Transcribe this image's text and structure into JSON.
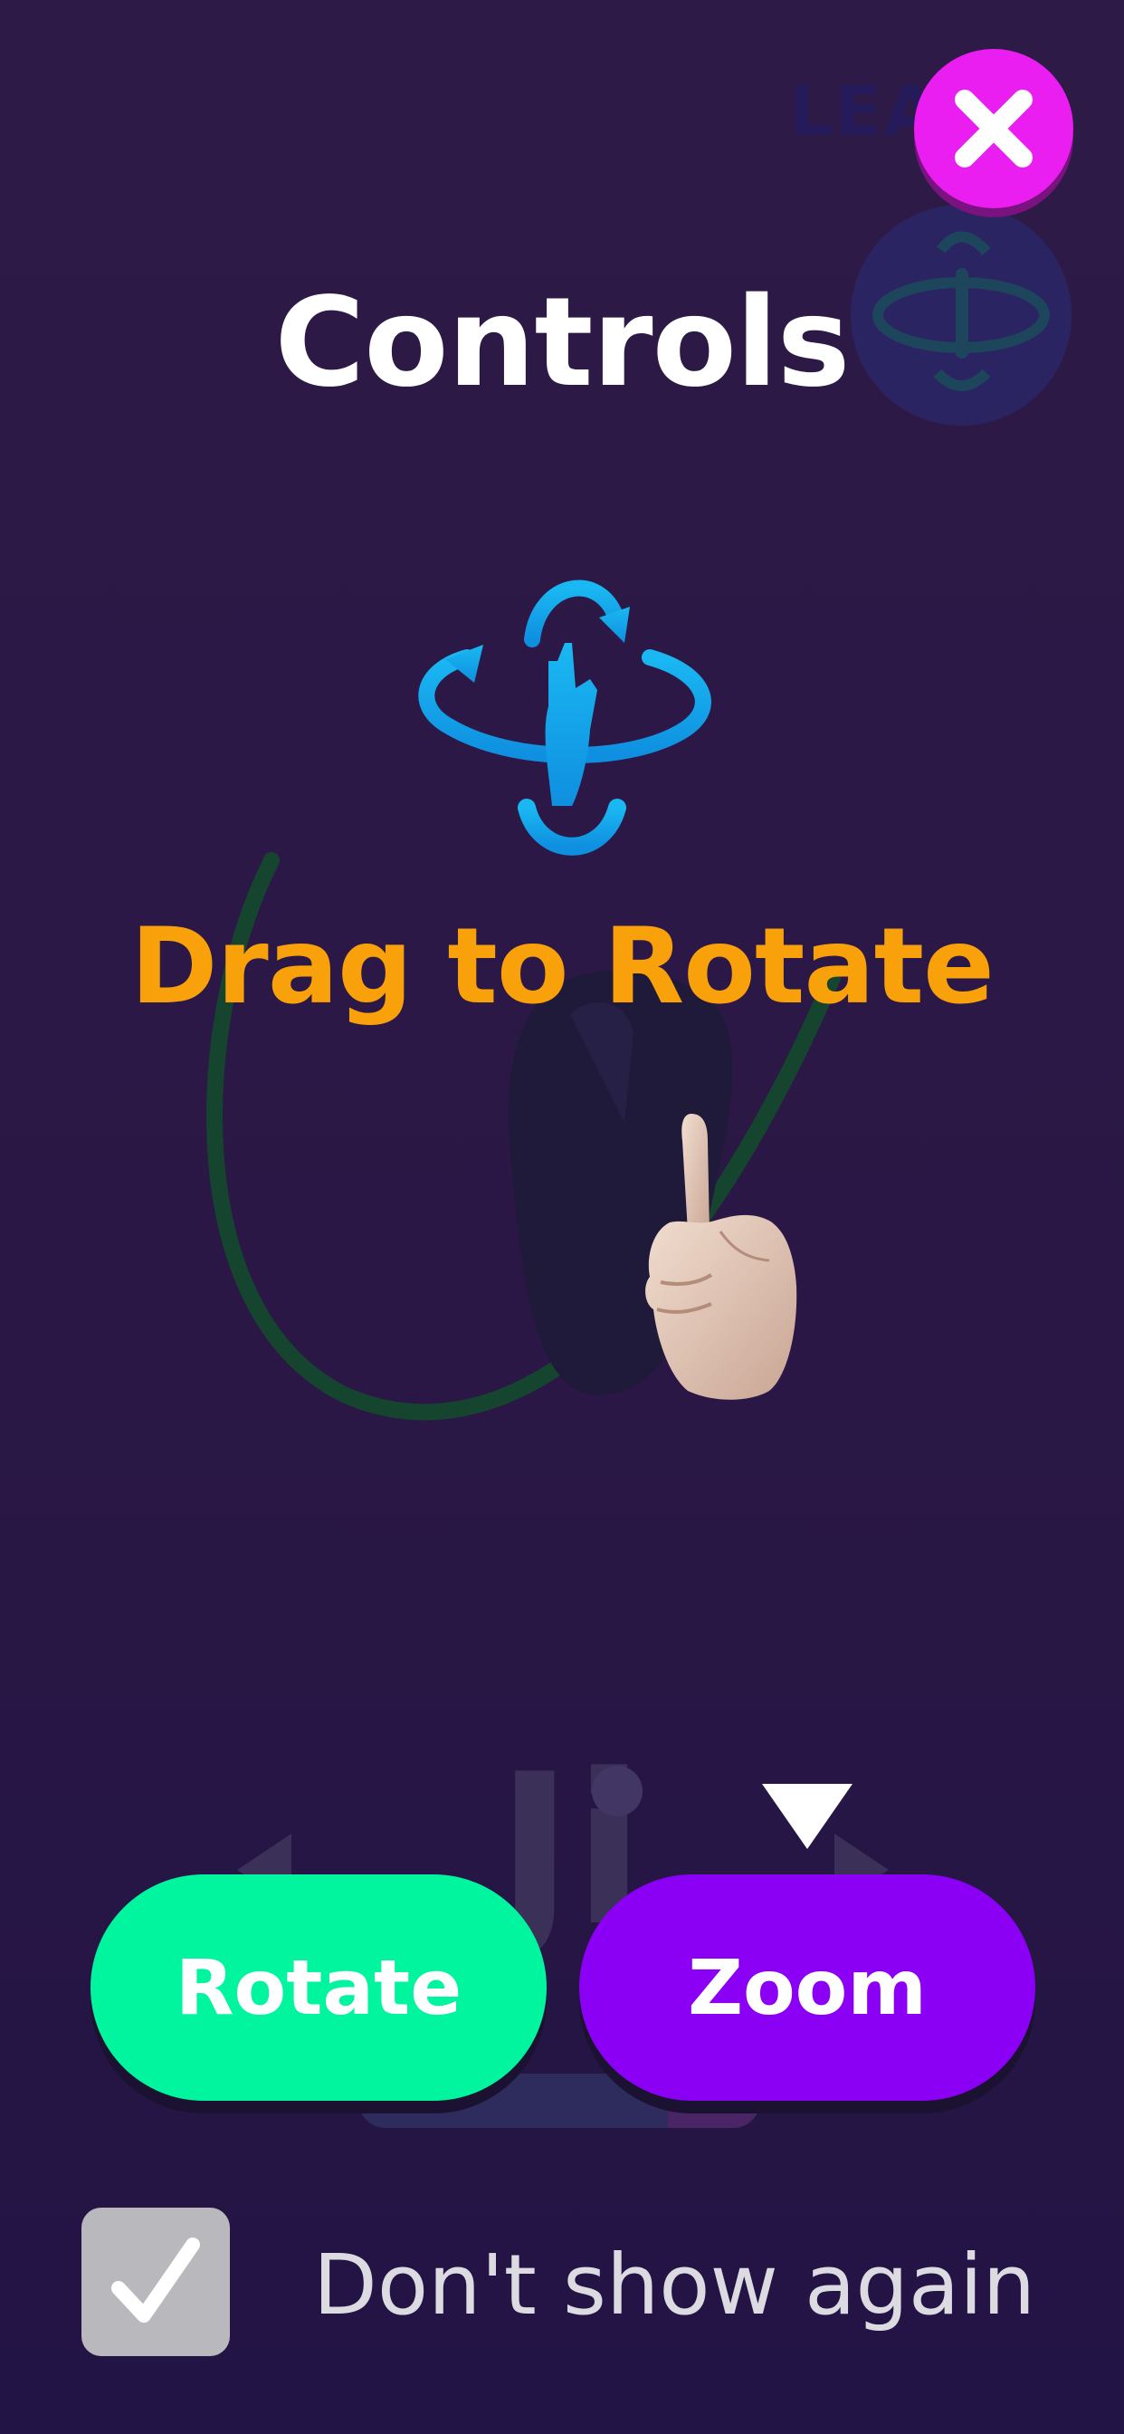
{
  "background": {
    "brand_text": "LEA",
    "word": "Ji"
  },
  "dialog": {
    "title": "Controls",
    "instruction": "Drag to Rotate",
    "close_icon": "close-icon",
    "rotate_icon": "rotate-gesture-icon",
    "hand_icon": "pointing-hand"
  },
  "tabs": {
    "rotate_label": "Rotate",
    "zoom_label": "Zoom",
    "active": "zoom"
  },
  "footer": {
    "checkbox_checked": true,
    "checkbox_label": "Don't show again"
  },
  "colors": {
    "background": "#2e1a47",
    "close_button": "#ea1ef0",
    "instruction": "#f9a10a",
    "rotate_button": "#00f59e",
    "zoom_button": "#8b00f5",
    "rotate_icon": "#15a9ef"
  }
}
